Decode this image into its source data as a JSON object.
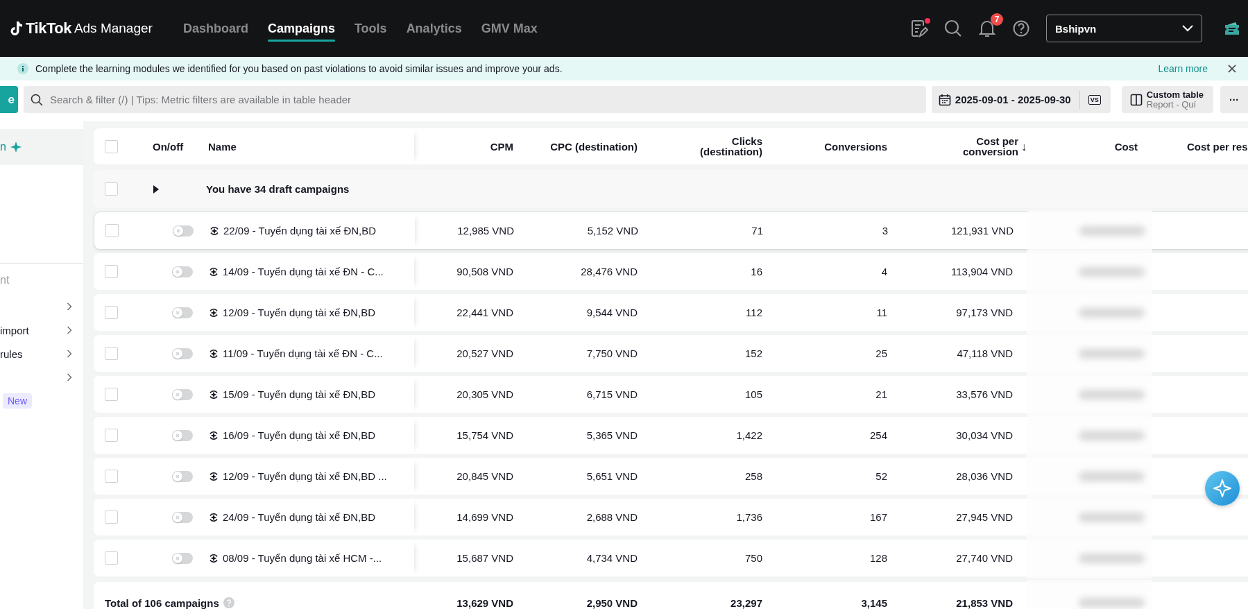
{
  "topbar": {
    "logo": {
      "brand": "TikTok",
      "product": "Ads Manager"
    },
    "nav": [
      {
        "label": "Dashboard",
        "selected": false
      },
      {
        "label": "Campaigns",
        "selected": true
      },
      {
        "label": "Tools",
        "selected": false
      },
      {
        "label": "Analytics",
        "selected": false
      },
      {
        "label": "GMV Max",
        "selected": false
      }
    ],
    "notes_unread": true,
    "notification_count": "7",
    "account": "Bshipvn"
  },
  "banner": {
    "message": "Complete the learning modules we identified for you based on past violations to avoid similar issues and improve your ads.",
    "link": "Learn more"
  },
  "toolbar": {
    "create_button": "e",
    "search": {
      "placeholder": "Search & filter (/) | Tips: Metric filters are available in table header"
    },
    "date_range": "2025-09-01 - 2025-09-30",
    "compare": "VS",
    "custom_table": {
      "title": "Custom table",
      "subtitle": "Report - Quí"
    },
    "more": "···"
  },
  "sidebar": {
    "items": [
      {
        "label": "n",
        "selected": true
      }
    ],
    "section_title": "nt",
    "menu": [
      {
        "has_submenu": true
      },
      {
        "label": "import",
        "has_submenu": true
      },
      {
        "label": "rules",
        "has_submenu": true
      },
      {
        "has_submenu": true
      },
      {
        "badge": "New"
      }
    ]
  },
  "table": {
    "columns": [
      {
        "label": "On/off"
      },
      {
        "label": "Name"
      },
      {
        "label": "CPM"
      },
      {
        "label": "CPC (destination)"
      },
      {
        "label": "Clicks (destination)"
      },
      {
        "label": "Conversions"
      },
      {
        "label": "Cost per conversion",
        "sort_arrow": "↓"
      },
      {
        "label": "Cost"
      },
      {
        "label": "Cost per res"
      }
    ],
    "select_all": {
      "checked": false
    },
    "draft_row": {
      "text": "You have 34 draft campaigns",
      "expanded": false,
      "checked": false
    },
    "row_checked": [
      false,
      false,
      false,
      false,
      false,
      false,
      false,
      false,
      false
    ],
    "rows": [
      {
        "on": false,
        "hovered": true,
        "name": "22/09 - Tuyển dụng tài xế ĐN,BD",
        "cpm": "12,985 VND",
        "cpc": "5,152 VND",
        "clicks": "71",
        "conversions": "3",
        "cost_per_conversion": "121,931 VND"
      },
      {
        "on": false,
        "hovered": false,
        "name": "14/09 - Tuyển dụng tài xế ĐN - C...",
        "cpm": "90,508 VND",
        "cpc": "28,476 VND",
        "clicks": "16",
        "conversions": "4",
        "cost_per_conversion": "113,904 VND"
      },
      {
        "on": false,
        "hovered": false,
        "name": "12/09 - Tuyển dụng tài xế ĐN,BD",
        "cpm": "22,441 VND",
        "cpc": "9,544 VND",
        "clicks": "112",
        "conversions": "11",
        "cost_per_conversion": "97,173 VND"
      },
      {
        "on": false,
        "hovered": false,
        "name": "11/09 - Tuyển dụng tài xế ĐN - C...",
        "cpm": "20,527 VND",
        "cpc": "7,750 VND",
        "clicks": "152",
        "conversions": "25",
        "cost_per_conversion": "47,118 VND"
      },
      {
        "on": false,
        "hovered": false,
        "name": "15/09 - Tuyển dụng tài xế ĐN,BD",
        "cpm": "20,305 VND",
        "cpc": "6,715 VND",
        "clicks": "105",
        "conversions": "21",
        "cost_per_conversion": "33,576 VND"
      },
      {
        "on": false,
        "hovered": false,
        "name": "16/09 - Tuyển dụng tài xế ĐN,BD",
        "cpm": "15,754 VND",
        "cpc": "5,365 VND",
        "clicks": "1,422",
        "conversions": "254",
        "cost_per_conversion": "30,034 VND"
      },
      {
        "on": false,
        "hovered": false,
        "name": "12/09 - Tuyển dụng tài xế ĐN,BD ...",
        "cpm": "20,845 VND",
        "cpc": "5,651 VND",
        "clicks": "258",
        "conversions": "52",
        "cost_per_conversion": "28,036 VND"
      },
      {
        "on": false,
        "hovered": false,
        "name": "24/09 - Tuyển dụng tài xế ĐN,BD",
        "cpm": "14,699 VND",
        "cpc": "2,688 VND",
        "clicks": "1,736",
        "conversions": "167",
        "cost_per_conversion": "27,945 VND"
      },
      {
        "on": false,
        "hovered": false,
        "name": "08/09 - Tuyển dụng tài xế HCM -...",
        "cpm": "15,687 VND",
        "cpc": "4,734 VND",
        "clicks": "750",
        "conversions": "128",
        "cost_per_conversion": "27,740 VND"
      }
    ],
    "total": {
      "label": "Total of 106 campaigns",
      "cpm": "13,629 VND",
      "cpc": "2,950 VND",
      "clicks": "23,297",
      "conversions": "3,145",
      "cost_per_conversion": "21,853 VND"
    }
  }
}
